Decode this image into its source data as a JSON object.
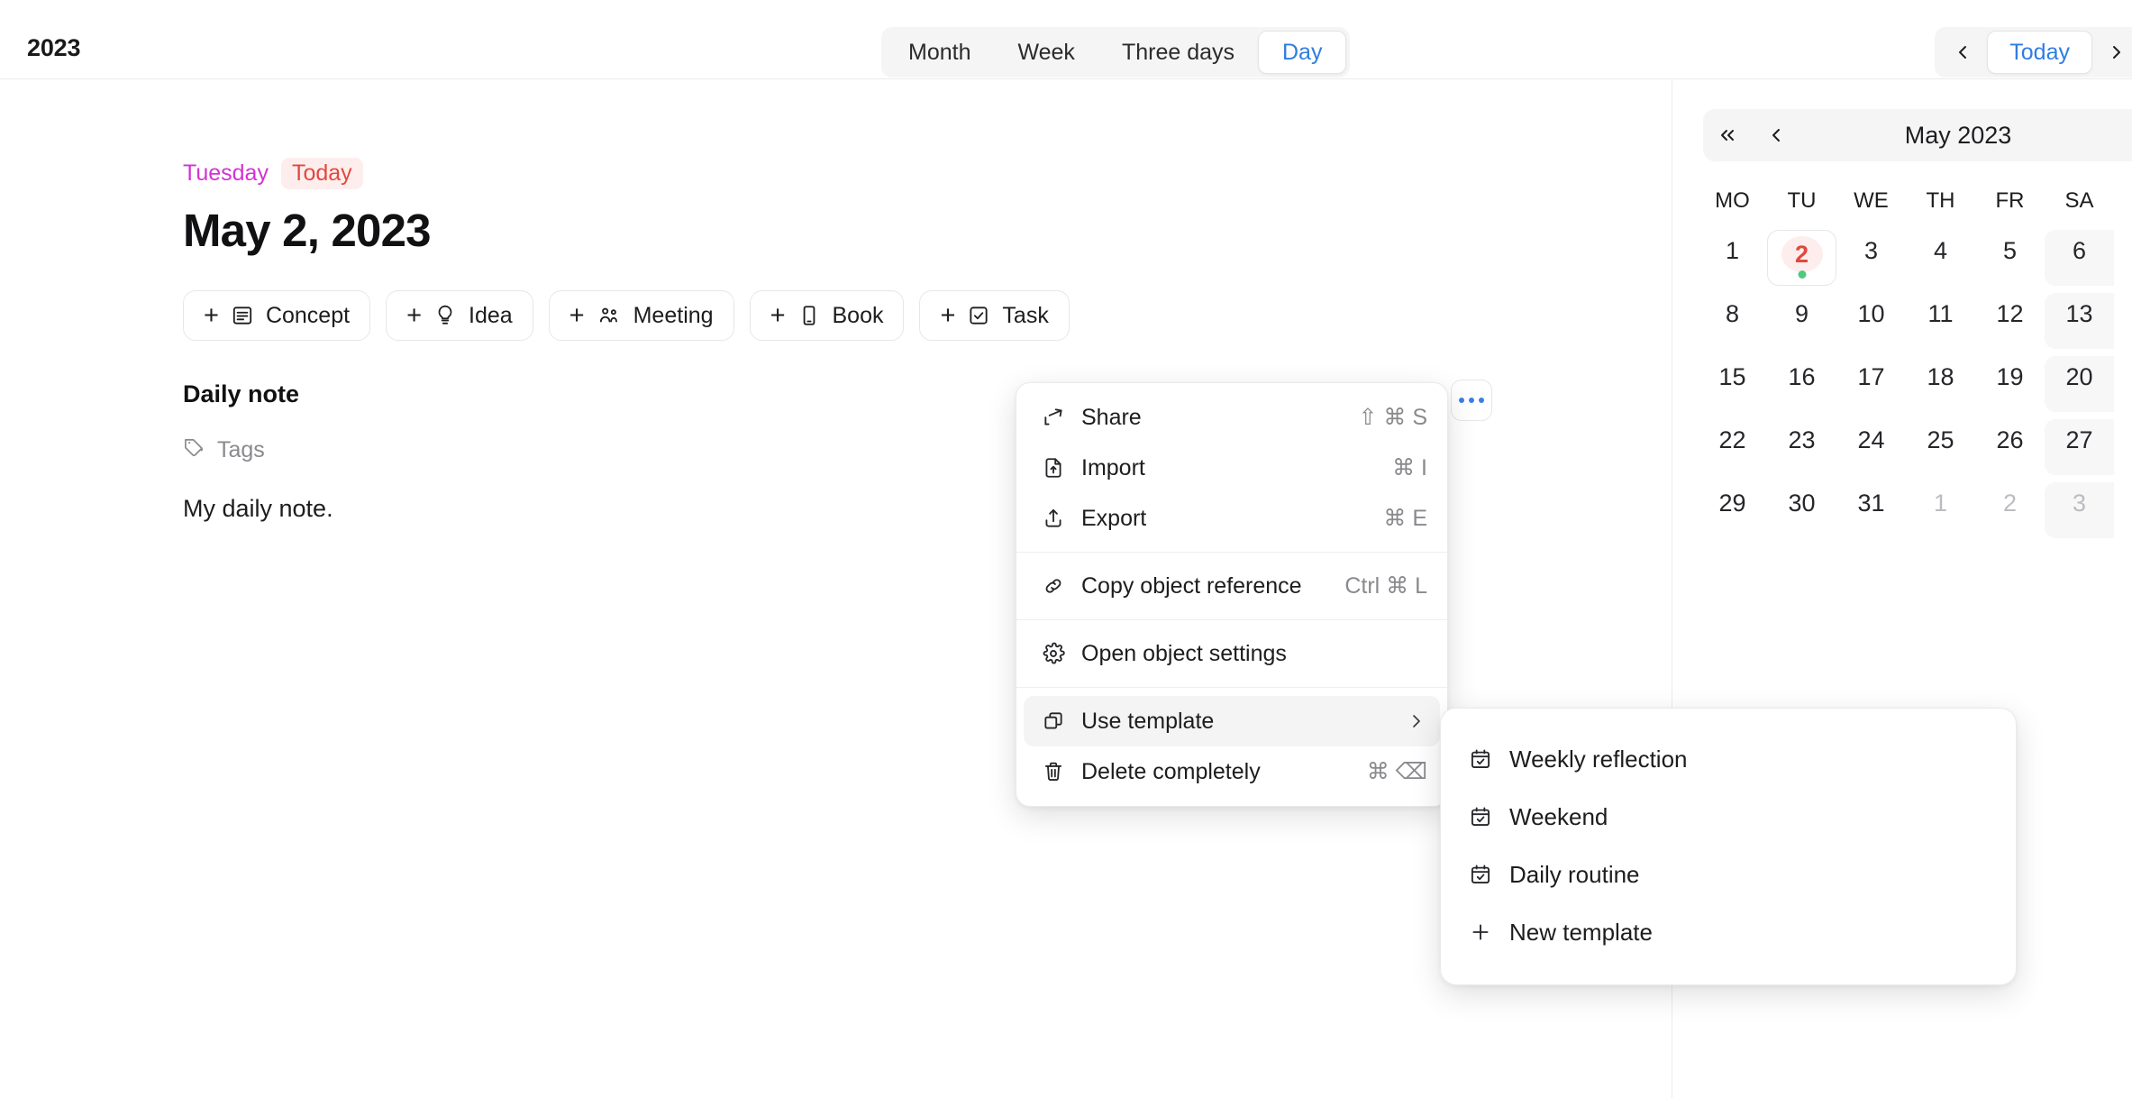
{
  "topbar": {
    "year": "2023",
    "view_tabs": [
      {
        "label": "Month",
        "active": false
      },
      {
        "label": "Week",
        "active": false
      },
      {
        "label": "Three days",
        "active": false
      },
      {
        "label": "Day",
        "active": true
      }
    ],
    "prev_icon": "chevron-left-icon",
    "today_label": "Today",
    "next_icon": "chevron-right-icon"
  },
  "day": {
    "weekday": "Tuesday",
    "today_badge": "Today",
    "date_title": "May 2, 2023",
    "chips": [
      {
        "label": "Concept",
        "icon": "document-icon"
      },
      {
        "label": "Idea",
        "icon": "lightbulb-icon"
      },
      {
        "label": "Meeting",
        "icon": "people-icon"
      },
      {
        "label": "Book",
        "icon": "book-icon"
      },
      {
        "label": "Task",
        "icon": "checkbox-icon"
      }
    ],
    "plus_symbol": "+",
    "note_title": "Daily note",
    "tags_label": "Tags",
    "note_body": "My daily note."
  },
  "context_menu": {
    "groups": [
      {
        "items": [
          {
            "label": "Share",
            "shortcut": "⇧ ⌘ S",
            "icon": "share-icon"
          },
          {
            "label": "Import",
            "shortcut": "⌘ I",
            "icon": "import-icon"
          },
          {
            "label": "Export",
            "shortcut": "⌘ E",
            "icon": "export-icon"
          }
        ]
      },
      {
        "items": [
          {
            "label": "Copy object reference",
            "shortcut": "Ctrl ⌘ L",
            "icon": "link-icon"
          }
        ]
      },
      {
        "items": [
          {
            "label": "Open object settings",
            "shortcut": "",
            "icon": "gear-icon"
          }
        ]
      },
      {
        "items": [
          {
            "label": "Use template",
            "shortcut": "",
            "icon": "copy-icon",
            "submenu": true,
            "hovered": true
          },
          {
            "label": "Delete completely",
            "shortcut": "⌘ ⌫",
            "icon": "trash-icon"
          }
        ]
      }
    ]
  },
  "template_submenu": {
    "items": [
      {
        "label": "Weekly reflection",
        "icon": "calendar-check-icon"
      },
      {
        "label": "Weekend",
        "icon": "calendar-check-icon"
      },
      {
        "label": "Daily routine",
        "icon": "calendar-check-icon"
      },
      {
        "label": "New template",
        "icon": "plus-icon"
      }
    ]
  },
  "calendar": {
    "first_icon": "chevrons-left-icon",
    "prev_icon": "chevron-left-icon",
    "month_label": "May 2023",
    "next_icon": "chevron-right-icon",
    "weekdays": [
      "MO",
      "TU",
      "WE",
      "TH",
      "FR",
      "SA"
    ],
    "weeks": [
      [
        {
          "d": "1"
        },
        {
          "d": "2",
          "today": true,
          "dot": true
        },
        {
          "d": "3"
        },
        {
          "d": "4"
        },
        {
          "d": "5"
        },
        {
          "d": "6",
          "weekend": true
        }
      ],
      [
        {
          "d": "8"
        },
        {
          "d": "9"
        },
        {
          "d": "10"
        },
        {
          "d": "11"
        },
        {
          "d": "12"
        },
        {
          "d": "13",
          "weekend": true
        }
      ],
      [
        {
          "d": "15"
        },
        {
          "d": "16"
        },
        {
          "d": "17"
        },
        {
          "d": "18"
        },
        {
          "d": "19"
        },
        {
          "d": "20",
          "weekend": true
        }
      ],
      [
        {
          "d": "22"
        },
        {
          "d": "23"
        },
        {
          "d": "24"
        },
        {
          "d": "25"
        },
        {
          "d": "26"
        },
        {
          "d": "27",
          "weekend": true
        }
      ],
      [
        {
          "d": "29"
        },
        {
          "d": "30"
        },
        {
          "d": "31"
        },
        {
          "d": "1",
          "other": true
        },
        {
          "d": "2",
          "other": true
        },
        {
          "d": "3",
          "other": true,
          "weekend": true
        }
      ]
    ]
  },
  "colors": {
    "accent_blue": "#2f7de1",
    "today_red": "#e2483f",
    "weekday_magenta": "#d332d3",
    "dot_green": "#4fc97f"
  }
}
